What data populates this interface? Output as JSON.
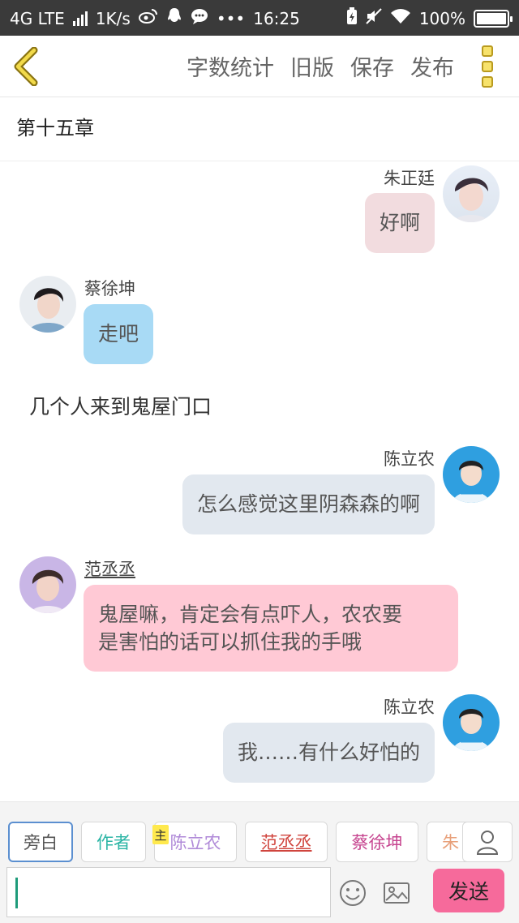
{
  "status_bar": {
    "network": "4G LTE",
    "speed": "1K/s",
    "time": "16:25",
    "battery": "100%",
    "icons": [
      "weibo-icon",
      "qq-icon",
      "chat-icon",
      "more-dots-icon",
      "charging-icon",
      "mute-icon",
      "wifi-icon",
      "battery-icon"
    ]
  },
  "toolbar": {
    "back_icon": "chevron-left-icon",
    "actions": [
      "字数统计",
      "旧版",
      "保存",
      "发布"
    ],
    "more_icon": "more-menu-icon"
  },
  "chapter": {
    "title": "第十五章"
  },
  "messages": [
    {
      "sender": "朱正廷",
      "text": "好啊",
      "side": "right",
      "bubble_color": "#f2dcdf"
    },
    {
      "sender": "蔡徐坤",
      "text": "走吧",
      "side": "left",
      "bubble_color": "#a8daf5"
    },
    {
      "narration": "几个人来到鬼屋门口"
    },
    {
      "sender": "陈立农",
      "text": "怎么感觉这里阴森森的啊",
      "side": "right",
      "bubble_color": "#e2e8ef"
    },
    {
      "sender": "范丞丞",
      "text_lines": [
        "鬼屋嘛，肯定会有点吓人，农农要",
        "是害怕的话可以抓住我的手哦"
      ],
      "side": "left",
      "bubble_color": "#ffc9d5"
    },
    {
      "sender": "陈立农",
      "text": "我……有什么好怕的",
      "side": "right",
      "bubble_color": "#e2e8ef"
    }
  ],
  "roles": [
    {
      "label": "旁白",
      "color": "#555555",
      "active": true
    },
    {
      "label": "作者",
      "color": "#2bb5a5"
    },
    {
      "label": "陈立农",
      "color": "#b08ad8",
      "badge": "主"
    },
    {
      "label": "范丞丞",
      "color": "#d0453e"
    },
    {
      "label": "蔡徐坤",
      "color": "#c6448f"
    },
    {
      "label": "朱",
      "color": "#e8a07a"
    }
  ],
  "composer": {
    "input_value": "",
    "emoji_icon": "emoji-icon",
    "image_icon": "image-icon",
    "person_icon": "person-icon",
    "send_label": "发送",
    "send_color": "#f66a9b"
  }
}
